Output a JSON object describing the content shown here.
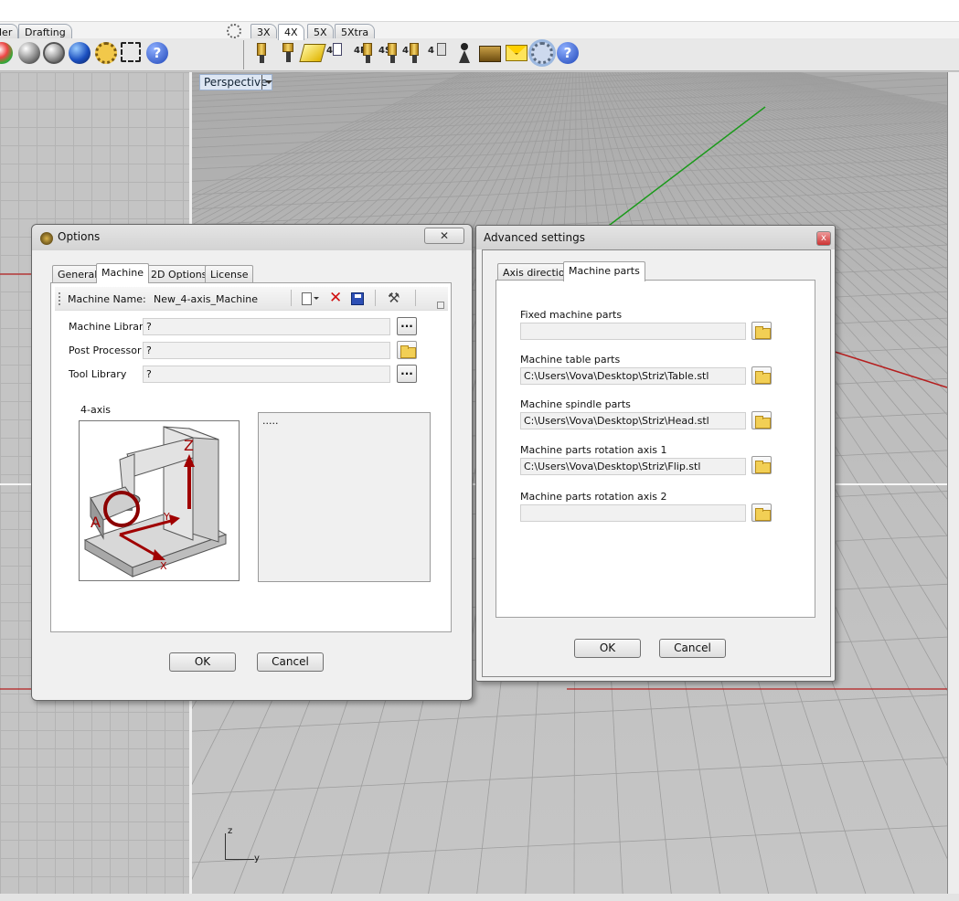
{
  "ribbon": {
    "tabs": [
      "ler",
      "Drafting",
      "3X",
      "4X",
      "5X",
      "5Xtra"
    ],
    "active_tab": "4X"
  },
  "viewport": {
    "label": "Perspective",
    "axis_z": "z",
    "axis_y": "y"
  },
  "options_dialog": {
    "title": "Options",
    "close": "✕",
    "tabs": [
      "General",
      "Machine",
      "2D Options",
      "License"
    ],
    "active_tab": "Machine",
    "machine_name_label": "Machine Name:",
    "machine_name_value": "New_4-axis_Machine",
    "rows": [
      {
        "label": "Machine Library",
        "value": "?",
        "button": "..."
      },
      {
        "label": "Post Processor",
        "value": "?",
        "button": "folder"
      },
      {
        "label": "Tool Library",
        "value": "?",
        "button": "..."
      }
    ],
    "preview_label": "4-axis",
    "preview_axes": {
      "z": "Z",
      "a": "A",
      "y": "Y",
      "x": "X"
    },
    "notes_text": ".....",
    "ok": "OK",
    "cancel": "Cancel"
  },
  "advanced_dialog": {
    "title": "Advanced settings",
    "close": "x",
    "tabs": [
      "Axis direction",
      "Machine parts"
    ],
    "active_tab": "Machine parts",
    "fields": [
      {
        "label": "Fixed machine parts",
        "value": ""
      },
      {
        "label": "Machine table parts",
        "value": "C:\\Users\\Vova\\Desktop\\Striz\\Table.stl"
      },
      {
        "label": "Machine spindle parts",
        "value": "C:\\Users\\Vova\\Desktop\\Striz\\Head.stl"
      },
      {
        "label": "Machine parts rotation axis 1",
        "value": "C:\\Users\\Vova\\Desktop\\Striz\\Flip.stl"
      },
      {
        "label": "Machine parts rotation axis 2",
        "value": ""
      }
    ],
    "ok": "OK",
    "cancel": "Cancel"
  },
  "colors": {
    "grid_x_axis": "#b51f1f",
    "grid_y_axis": "#1a9a1a",
    "preview_accent": "#a00000"
  }
}
